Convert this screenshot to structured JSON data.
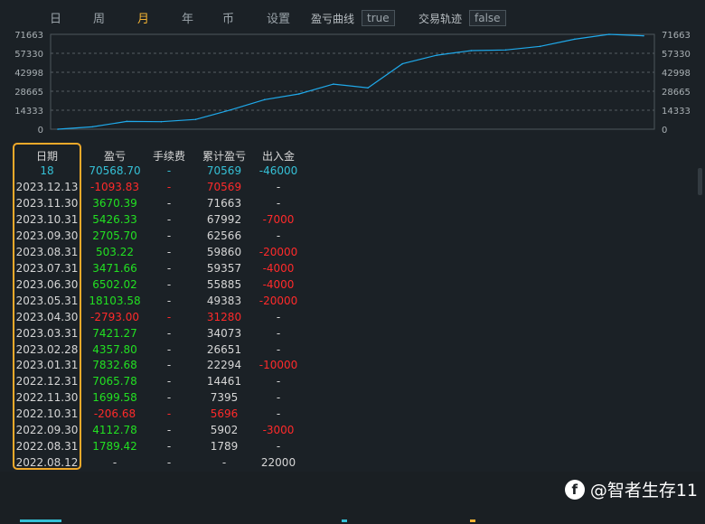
{
  "tabs": [
    {
      "label": "日",
      "active": false
    },
    {
      "label": "周",
      "active": false
    },
    {
      "label": "月",
      "active": true
    },
    {
      "label": "年",
      "active": false
    },
    {
      "label": "币",
      "active": false
    },
    {
      "label": "设置",
      "active": false
    }
  ],
  "options": {
    "pnl_curve_label": "盈亏曲线",
    "pnl_curve_value": "true",
    "trade_track_label": "交易轨迹",
    "trade_track_value": "false"
  },
  "colors": {
    "accent": "#f2b233",
    "positive": "#22e022",
    "negative": "#ff2a2a",
    "cyan": "#35c0d6",
    "line": "#1fa9ea"
  },
  "chart_data": {
    "type": "line",
    "x": [
      "2022.08.12",
      "2022.08.31",
      "2022.09.30",
      "2022.10.31",
      "2022.11.30",
      "2022.12.31",
      "2023.01.31",
      "2023.02.28",
      "2023.03.31",
      "2023.04.30",
      "2023.05.31",
      "2023.06.30",
      "2023.07.31",
      "2023.08.31",
      "2023.09.30",
      "2023.10.31",
      "2023.11.30",
      "2023.12.13"
    ],
    "y": [
      0,
      1789,
      5902,
      5696,
      7395,
      14461,
      22294,
      26651,
      34073,
      31280,
      49383,
      55885,
      59357,
      59860,
      62566,
      67992,
      71663,
      70569
    ],
    "yticks": [
      "0",
      "14333",
      "28665",
      "42998",
      "57330",
      "71663"
    ],
    "ylim": [
      0,
      71663
    ],
    "grid": true
  },
  "table": {
    "headers": {
      "date": "日期",
      "pnl": "盈亏",
      "fee": "手续费",
      "cum": "累计盈亏",
      "io": "出入金"
    },
    "summary": {
      "date": "18",
      "pnl": "70568.70",
      "fee": "-",
      "cum": "70569",
      "io": "-46000"
    },
    "rows": [
      {
        "date": "2023.12.13",
        "pnl": "-1093.83",
        "fee": "-",
        "cum": "70569",
        "io": "-",
        "neg": true,
        "io_neg": false
      },
      {
        "date": "2023.11.30",
        "pnl": "3670.39",
        "fee": "-",
        "cum": "71663",
        "io": "-",
        "neg": false,
        "io_neg": false
      },
      {
        "date": "2023.10.31",
        "pnl": "5426.33",
        "fee": "-",
        "cum": "67992",
        "io": "-7000",
        "neg": false,
        "io_neg": true
      },
      {
        "date": "2023.09.30",
        "pnl": "2705.70",
        "fee": "-",
        "cum": "62566",
        "io": "-",
        "neg": false,
        "io_neg": false
      },
      {
        "date": "2023.08.31",
        "pnl": "503.22",
        "fee": "-",
        "cum": "59860",
        "io": "-20000",
        "neg": false,
        "io_neg": true
      },
      {
        "date": "2023.07.31",
        "pnl": "3471.66",
        "fee": "-",
        "cum": "59357",
        "io": "-4000",
        "neg": false,
        "io_neg": true
      },
      {
        "date": "2023.06.30",
        "pnl": "6502.02",
        "fee": "-",
        "cum": "55885",
        "io": "-4000",
        "neg": false,
        "io_neg": true
      },
      {
        "date": "2023.05.31",
        "pnl": "18103.58",
        "fee": "-",
        "cum": "49383",
        "io": "-20000",
        "neg": false,
        "io_neg": true
      },
      {
        "date": "2023.04.30",
        "pnl": "-2793.00",
        "fee": "-",
        "cum": "31280",
        "io": "-",
        "neg": true,
        "io_neg": false
      },
      {
        "date": "2023.03.31",
        "pnl": "7421.27",
        "fee": "-",
        "cum": "34073",
        "io": "-",
        "neg": false,
        "io_neg": false
      },
      {
        "date": "2023.02.28",
        "pnl": "4357.80",
        "fee": "-",
        "cum": "26651",
        "io": "-",
        "neg": false,
        "io_neg": false
      },
      {
        "date": "2023.01.31",
        "pnl": "7832.68",
        "fee": "-",
        "cum": "22294",
        "io": "-10000",
        "neg": false,
        "io_neg": true
      },
      {
        "date": "2022.12.31",
        "pnl": "7065.78",
        "fee": "-",
        "cum": "14461",
        "io": "-",
        "neg": false,
        "io_neg": false
      },
      {
        "date": "2022.11.30",
        "pnl": "1699.58",
        "fee": "-",
        "cum": "7395",
        "io": "-",
        "neg": false,
        "io_neg": false
      },
      {
        "date": "2022.10.31",
        "pnl": "-206.68",
        "fee": "-",
        "cum": "5696",
        "io": "-",
        "neg": true,
        "io_neg": false
      },
      {
        "date": "2022.09.30",
        "pnl": "4112.78",
        "fee": "-",
        "cum": "5902",
        "io": "-3000",
        "neg": false,
        "io_neg": true
      },
      {
        "date": "2022.08.31",
        "pnl": "1789.42",
        "fee": "-",
        "cum": "1789",
        "io": "-",
        "neg": false,
        "io_neg": false
      },
      {
        "date": "2022.08.12",
        "pnl": "-",
        "fee": "-",
        "cum": "-",
        "io": "22000",
        "neg": false,
        "io_neg": false,
        "plain": true
      }
    ]
  },
  "watermark": {
    "icon": "facebook-icon",
    "text": "@智者生存11"
  }
}
